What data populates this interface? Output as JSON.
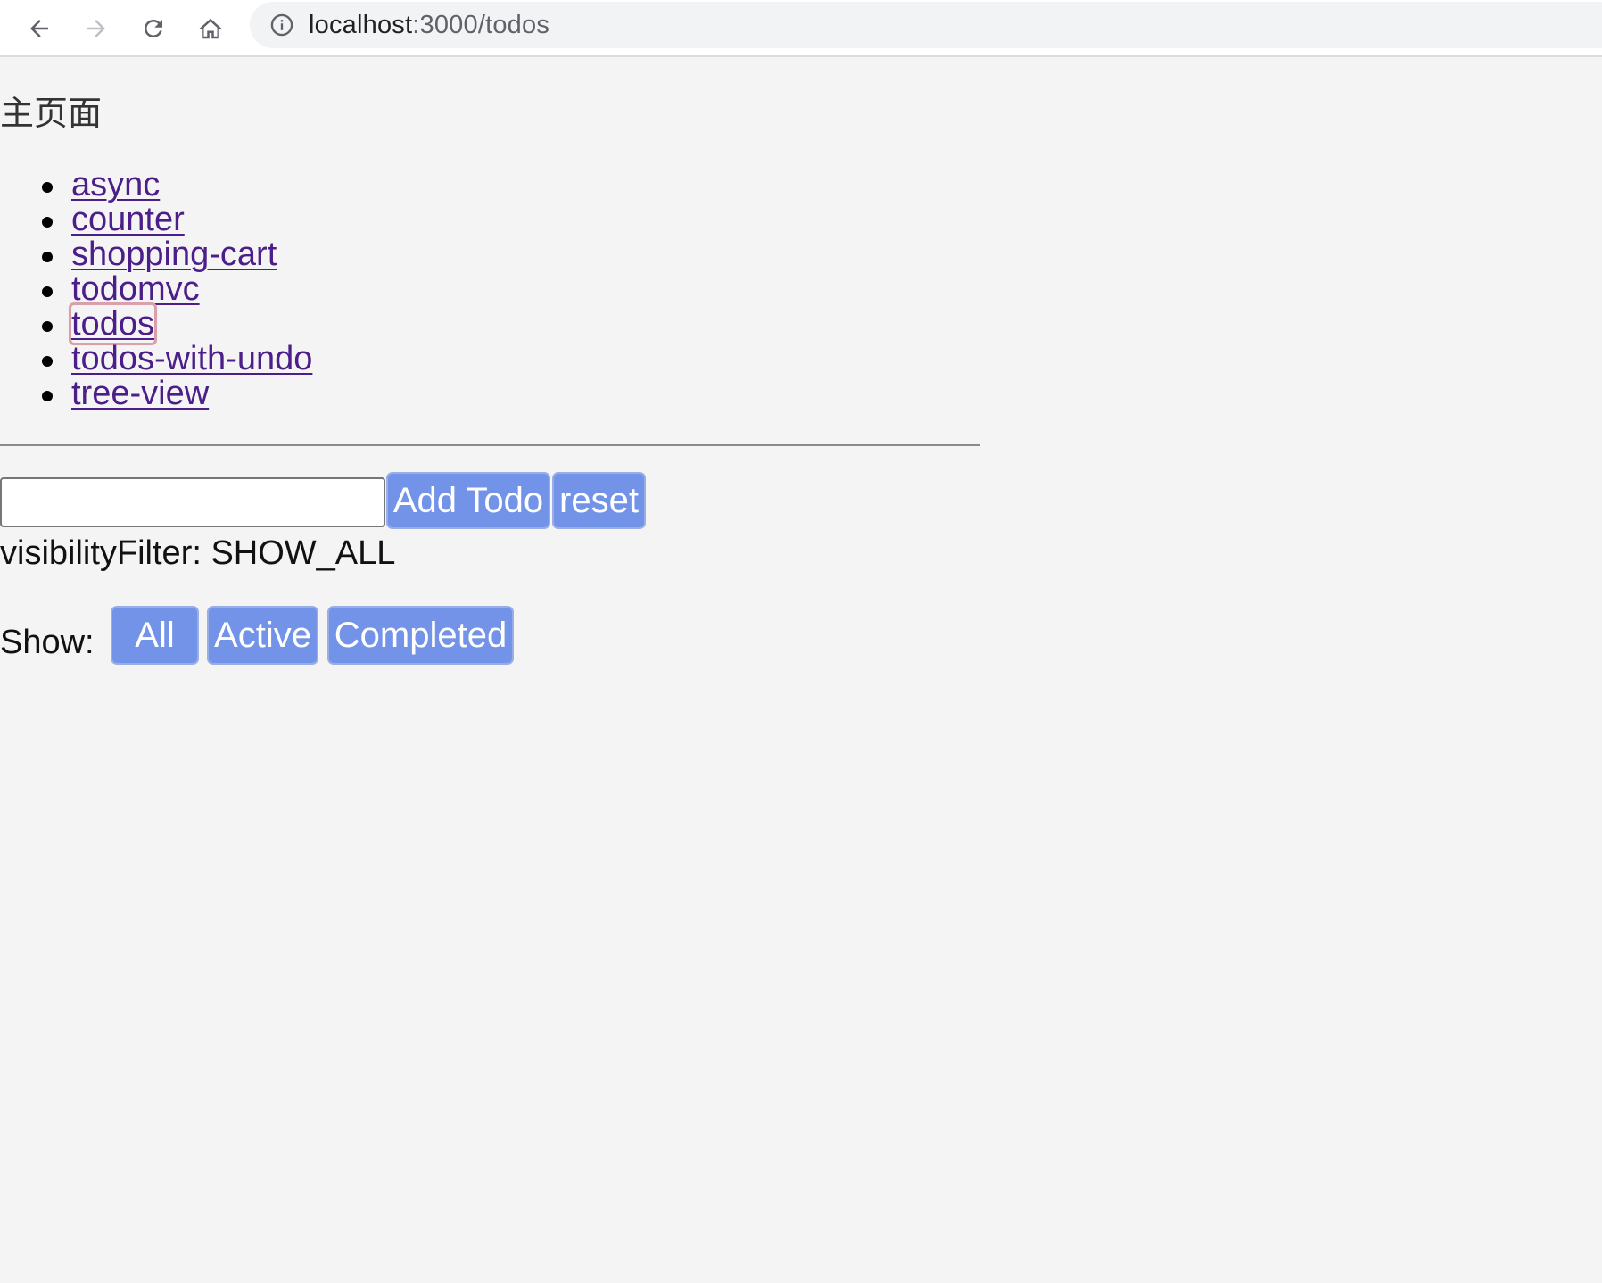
{
  "browser": {
    "url_host": "localhost",
    "url_path": ":3000/todos",
    "icons": {
      "back": "arrow-left-icon",
      "forward": "arrow-right-icon",
      "reload": "reload-icon",
      "home": "home-icon",
      "site_info": "info-icon"
    }
  },
  "page": {
    "title": "主页面",
    "nav_links": [
      {
        "label": "async"
      },
      {
        "label": "counter"
      },
      {
        "label": "shopping-cart"
      },
      {
        "label": "todomvc"
      },
      {
        "label": "todos"
      },
      {
        "label": "todos-with-undo"
      },
      {
        "label": "tree-view"
      }
    ]
  },
  "todo_form": {
    "input_value": "",
    "add_label": "Add Todo",
    "reset_label": "reset"
  },
  "status": {
    "visibility_filter": "visibilityFilter: SHOW_ALL"
  },
  "filters": {
    "label": "Show:",
    "all": "All",
    "active": "Active",
    "completed": "Completed"
  },
  "colors": {
    "button_bg": "#7393e8",
    "link": "#4b1e8a",
    "page_bg": "#f4f4f4"
  }
}
